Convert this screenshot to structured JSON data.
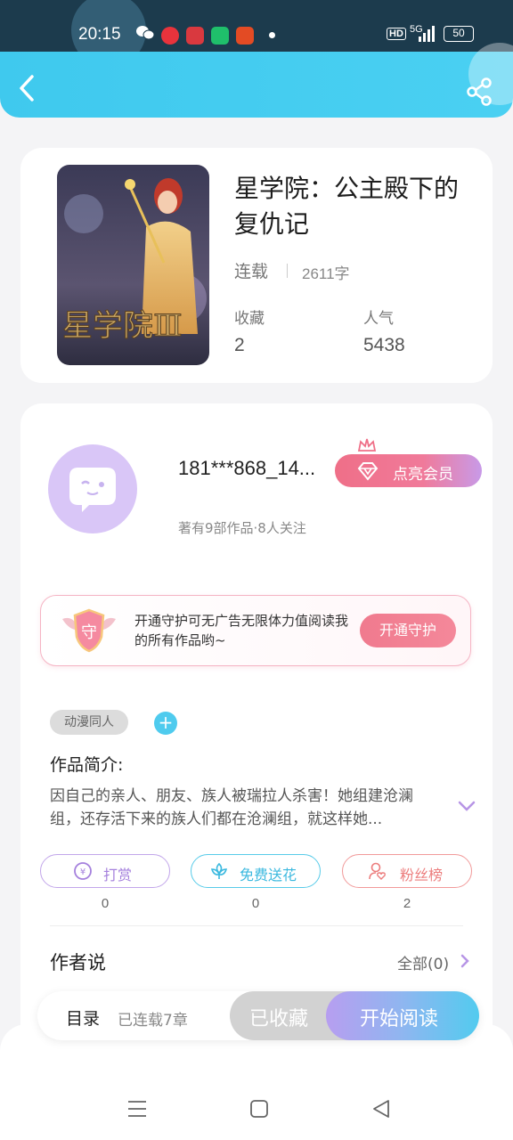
{
  "status_bar": {
    "time": "20:15",
    "hd": "HD",
    "network": "5G",
    "battery": "50",
    "icons": [
      "wechat-icon",
      "red-app-icon",
      "news-app-icon",
      "green-app-icon",
      "orange-app-icon",
      "notification-dot"
    ]
  },
  "header": {
    "back_icon": "chevron-left-icon",
    "share_icon": "share-icon",
    "color": "#44ccef"
  },
  "book": {
    "title": "星学院：公主殿下的复仇记",
    "status": "连载",
    "word_count": "2611字",
    "favorites_label": "收藏",
    "favorites_value": "2",
    "popularity_label": "人气",
    "popularity_value": "5438",
    "cover_text": "星学院Ⅲ"
  },
  "author": {
    "name": "181***868_14...",
    "vip_button": "点亮会员",
    "meta": "著有9部作品·8人关注"
  },
  "guard": {
    "text": "开通守护可无广告无限体力值阅读我的所有作品哟~",
    "shield_text": "守",
    "button": "开通守护"
  },
  "tags": {
    "items": [
      "动漫同人"
    ],
    "add_label": "+"
  },
  "intro": {
    "label": "作品简介:",
    "text": "因自己的亲人、朋友、族人被瑞拉人杀害！她组建沧澜组，还存活下来的族人们都在沧澜组，就这样她..."
  },
  "actions": [
    {
      "label": "打赏",
      "count": "0",
      "icon": "coin-icon",
      "color": "#a581dd"
    },
    {
      "label": "免费送花",
      "count": "0",
      "icon": "flower-icon",
      "color": "#3cb9df"
    },
    {
      "label": "粉丝榜",
      "count": "2",
      "icon": "fan-heart-icon",
      "color": "#ec7d7d"
    }
  ],
  "author_says": {
    "label": "作者说",
    "all": "全部(0)"
  },
  "bottom_bar": {
    "toc_label": "目录",
    "toc_count": "已连载7章",
    "collected": "已收藏",
    "read": "开始阅读"
  },
  "system_nav": [
    "menu-icon",
    "home-icon",
    "back-icon"
  ]
}
